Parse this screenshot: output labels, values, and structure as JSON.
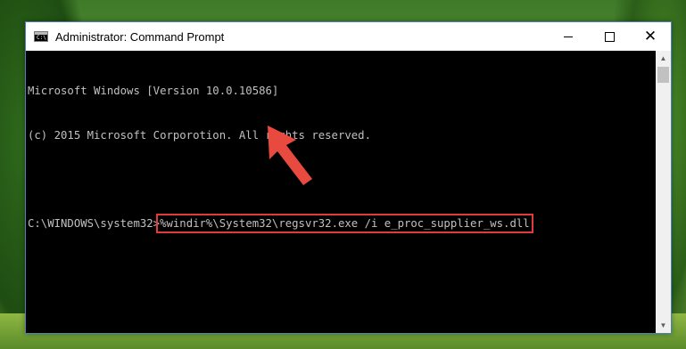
{
  "window": {
    "title": "Administrator: Command Prompt",
    "icon": "cmd-icon",
    "controls": {
      "minimize": "minimize-icon",
      "maximize": "maximize-icon",
      "close": "close-icon"
    }
  },
  "console": {
    "lines": [
      "Microsoft Windows [Version 10.0.10586]",
      "(c) 2015 Microsoft Corporotion. All rights reserved.",
      ""
    ],
    "prompt": "C:\\WINDOWS\\system32>",
    "command": "%windir%\\System32\\regsvr32.exe /i e_proc_supplier_ws.dll"
  },
  "colors": {
    "console_bg": "#000000",
    "console_text": "#c0c0c0",
    "highlight": "#e03a3a",
    "arrow": "#e84a3f"
  },
  "icons": {
    "app": "cmd-icon",
    "scroll_up": "scroll-up-icon",
    "scroll_down": "scroll-down-icon",
    "annotation": "red-arrow-icon"
  }
}
